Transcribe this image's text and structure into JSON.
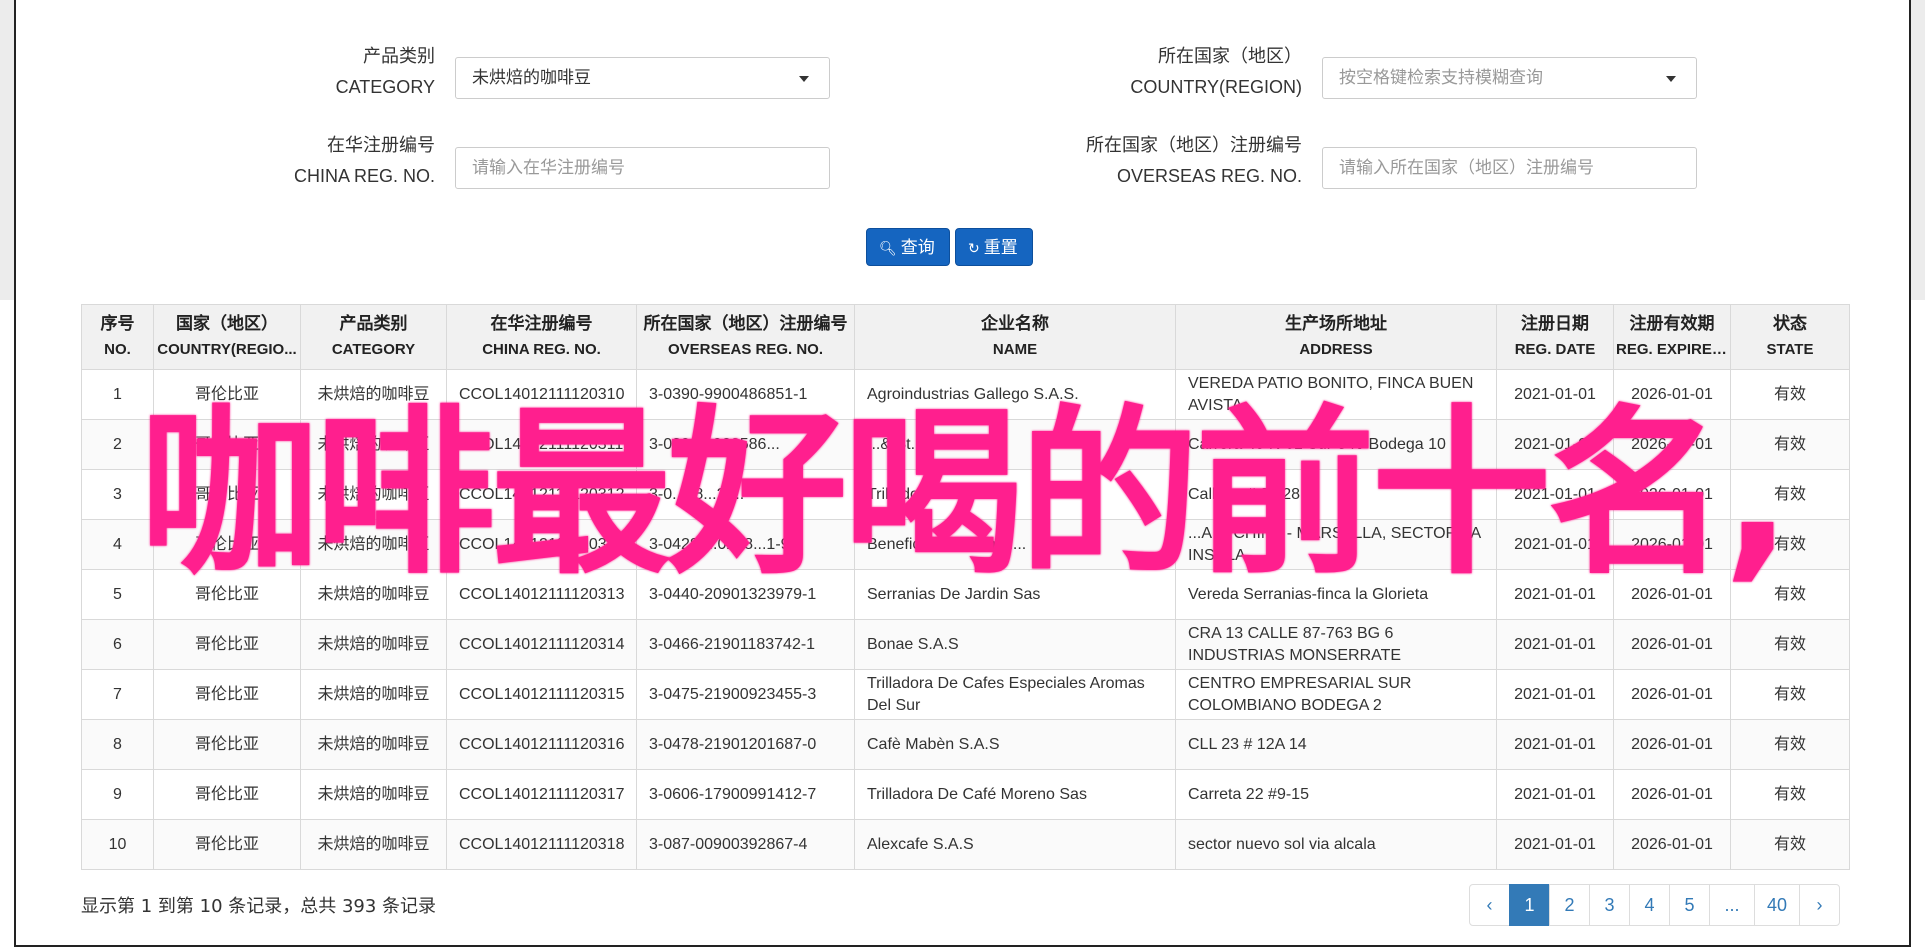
{
  "form": {
    "category": {
      "label_cn": "产品类别",
      "label_en": "CATEGORY",
      "value": "未烘焙的咖啡豆"
    },
    "country": {
      "label_cn": "所在国家（地区）",
      "label_en": "COUNTRY(REGION)",
      "placeholder": "按空格键检索支持模糊查询"
    },
    "china_reg": {
      "label_cn": "在华注册编号",
      "label_en": "CHINA REG. NO.",
      "placeholder": "请输入在华注册编号"
    },
    "overseas_reg": {
      "label_cn": "所在国家（地区）注册编号",
      "label_en": "OVERSEAS REG. NO.",
      "placeholder": "请输入所在国家（地区）注册编号"
    },
    "search_button": "查询",
    "reset_button": "重置"
  },
  "table": {
    "headers": [
      {
        "cn": "序号",
        "en": "NO."
      },
      {
        "cn": "国家（地区）",
        "en": "COUNTRY(REGIO..."
      },
      {
        "cn": "产品类别",
        "en": "CATEGORY"
      },
      {
        "cn": "在华注册编号",
        "en": "CHINA REG. NO."
      },
      {
        "cn": "所在国家（地区）注册编号",
        "en": "OVERSEAS REG. NO."
      },
      {
        "cn": "企业名称",
        "en": "NAME"
      },
      {
        "cn": "生产场所地址",
        "en": "ADDRESS"
      },
      {
        "cn": "注册日期",
        "en": "REG. DATE"
      },
      {
        "cn": "注册有效期",
        "en": "REG. EXPIRE ..."
      },
      {
        "cn": "状态",
        "en": "STATE"
      }
    ],
    "rows": [
      [
        "1",
        "哥伦比亚",
        "未烘焙的咖啡豆",
        "CCOL14012111120310",
        "3-0390-9900486851-1",
        "Agroindustrias Gallego S.A.S.",
        "VEREDA PATIO BONITO, FINCA BUEN AVISTA",
        "2021-01-01",
        "2026-01-01",
        "有效"
      ],
      [
        "2",
        "哥伦比亚",
        "未烘焙的咖啡豆",
        "CCOL14012111120311",
        "3-0392-1900586...",
        "...& St...",
        "Carrera 49 N 61 Sur-540 Bodega 10",
        "2021-01-01",
        "2026-01-01",
        "有效"
      ],
      [
        "3",
        "哥伦比亚",
        "未烘焙的咖啡豆",
        "CCOL14012111120312",
        "3-0...48...2-...",
        "Trilladora Roya...",
        "Calle ... # 8...28",
        "2021-01-01",
        "2026-01-01",
        "有效"
      ],
      [
        "4",
        "哥伦比亚",
        "未烘焙的咖啡豆",
        "CCOL14012111120312",
        "3-0428-...0298...1-9",
        "Beneficiadero ...Insu...",
        "...A ... CHINA - MARSELLA, SECTOR LA INSULA",
        "2021-01-01",
        "2026-01-01",
        "有效"
      ],
      [
        "5",
        "哥伦比亚",
        "未烘焙的咖啡豆",
        "CCOL14012111120313",
        "3-0440-20901323979-1",
        "Serranias De Jardin Sas",
        "Vereda Serranias-finca la Glorieta",
        "2021-01-01",
        "2026-01-01",
        "有效"
      ],
      [
        "6",
        "哥伦比亚",
        "未烘焙的咖啡豆",
        "CCOL14012111120314",
        "3-0466-21901183742-1",
        "Bonae S.A.S",
        "CRA 13 CALLE 87-763 BG 6 INDUSTRIAS MONSERRATE",
        "2021-01-01",
        "2026-01-01",
        "有效"
      ],
      [
        "7",
        "哥伦比亚",
        "未烘焙的咖啡豆",
        "CCOL14012111120315",
        "3-0475-21900923455-3",
        "Trilladora De Cafes Especiales Aromas Del Sur",
        "CENTRO EMPRESARIAL SUR COLOMBIANO BODEGA 2",
        "2021-01-01",
        "2026-01-01",
        "有效"
      ],
      [
        "8",
        "哥伦比亚",
        "未烘焙的咖啡豆",
        "CCOL14012111120316",
        "3-0478-21901201687-0",
        "Cafè Mabèn S.A.S",
        "CLL 23 # 12A 14",
        "2021-01-01",
        "2026-01-01",
        "有效"
      ],
      [
        "9",
        "哥伦比亚",
        "未烘焙的咖啡豆",
        "CCOL14012111120317",
        "3-0606-17900991412-7",
        "Trilladora De Café Moreno Sas",
        "Carreta 22 #9-15",
        "2021-01-01",
        "2026-01-01",
        "有效"
      ],
      [
        "10",
        "哥伦比亚",
        "未烘焙的咖啡豆",
        "CCOL14012111120318",
        "3-087-00900392867-4",
        "Alexcafe S.A.S",
        "sector nuevo sol via alcala",
        "2021-01-01",
        "2026-01-01",
        "有效"
      ]
    ]
  },
  "summary": "显示第 1 到第 10 条记录，总共 393 条记录",
  "pagination": [
    "‹",
    "1",
    "2",
    "3",
    "4",
    "5",
    "...",
    "40",
    "›"
  ],
  "overlay_text": "咖啡最好喝的前十名,",
  "colors": {
    "primary": "#1565c0",
    "overlay": "#ff1f8e",
    "page_active": "#337ab7"
  }
}
